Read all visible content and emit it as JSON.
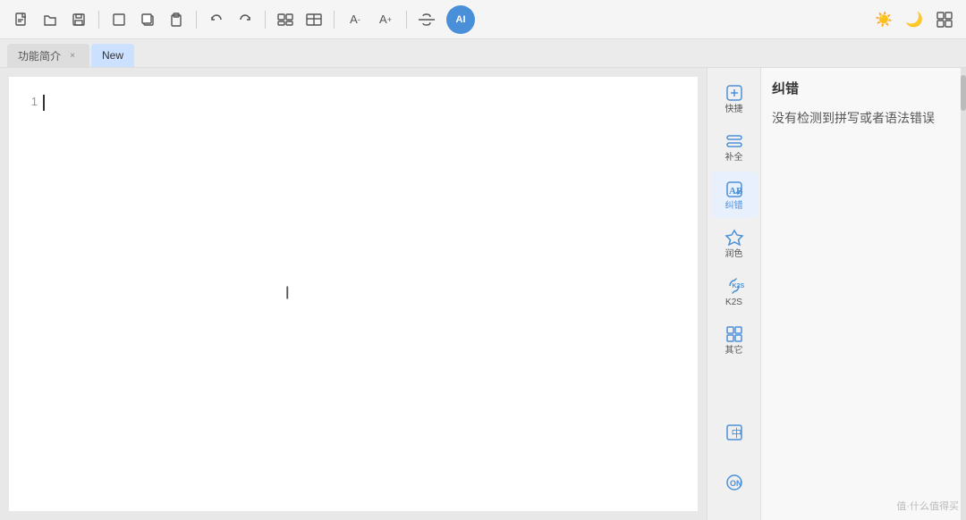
{
  "toolbar": {
    "buttons": [
      {
        "name": "new-file",
        "icon": "📄",
        "unicode": "🗋"
      },
      {
        "name": "open-file",
        "icon": "📂",
        "unicode": "🗁"
      },
      {
        "name": "save-file",
        "icon": "💾",
        "unicode": "🖫"
      }
    ],
    "ai_label": "AI"
  },
  "tabs": [
    {
      "id": "tab-intro",
      "label": "功能简介",
      "closable": true,
      "active": false
    },
    {
      "id": "tab-new",
      "label": "New",
      "closable": false,
      "active": true
    }
  ],
  "editor": {
    "line_number": "1",
    "cursor_visible": true
  },
  "sidebar": {
    "items": [
      {
        "id": "kuaijie",
        "label": "快捷",
        "active": false
      },
      {
        "id": "buquan",
        "label": "补全",
        "active": false
      },
      {
        "id": "jiucuo",
        "label": "纠错",
        "active": true
      },
      {
        "id": "runse",
        "label": "润色",
        "active": false
      },
      {
        "id": "k2s",
        "label": "K2S",
        "active": false
      },
      {
        "id": "qita",
        "label": "其它",
        "active": false
      }
    ],
    "bottom_items": [
      {
        "id": "zhong",
        "label": "中"
      },
      {
        "id": "on",
        "label": "ON"
      }
    ]
  },
  "panel": {
    "title": "纠错",
    "message": "没有检测到拼写或者语法错误"
  },
  "watermark": "值·什么值得买"
}
